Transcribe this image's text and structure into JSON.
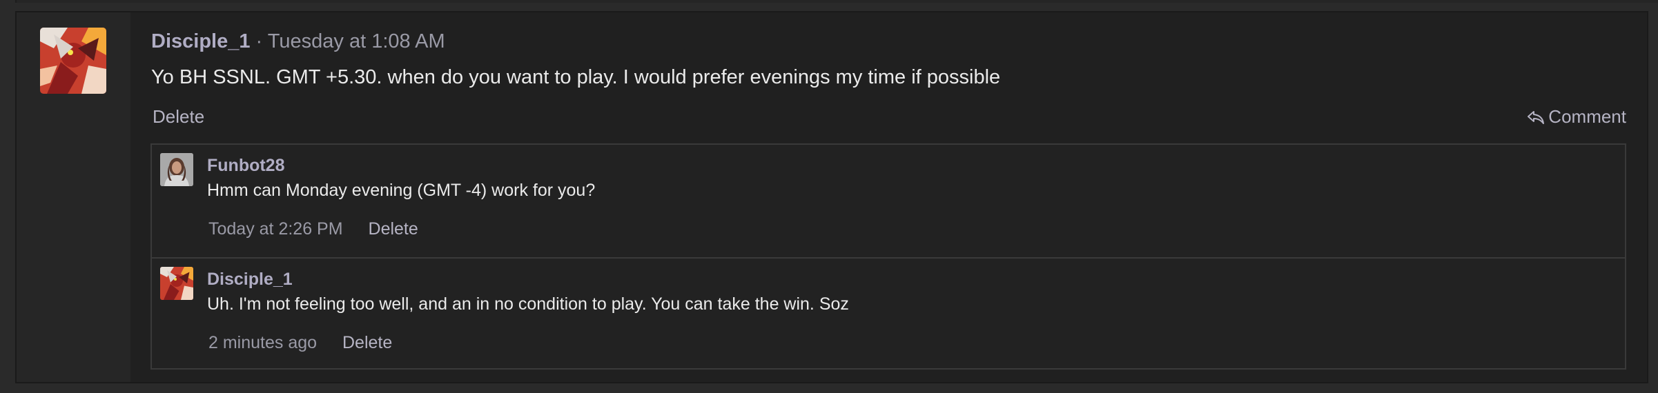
{
  "post": {
    "author": "Disciple_1",
    "separator": "·",
    "time": "Tuesday at 1:08 AM",
    "body": "Yo BH SSNL. GMT +5.30. when do you want to play. I would prefer evenings my time if possible",
    "actions": {
      "delete_label": "Delete",
      "comment_label": "Comment",
      "comment_icon": "reply-arrow-icon"
    }
  },
  "comments": [
    {
      "author": "Funbot28",
      "text": "Hmm can Monday evening (GMT -4) work for you?",
      "time": "Today at 2:26 PM",
      "delete_label": "Delete"
    },
    {
      "author": "Disciple_1",
      "text": "Uh. I'm not feeling too well, and an in no condition to play. You can take the win. Soz",
      "time": "2 minutes ago",
      "delete_label": "Delete"
    }
  ],
  "colors": {
    "page_bg": "#2a2a2a",
    "post_bg": "#202020",
    "avatar_column_bg": "#262626",
    "username": "#b0adc4",
    "body_text": "#ebebeb",
    "muted": "#9a9aa6"
  }
}
